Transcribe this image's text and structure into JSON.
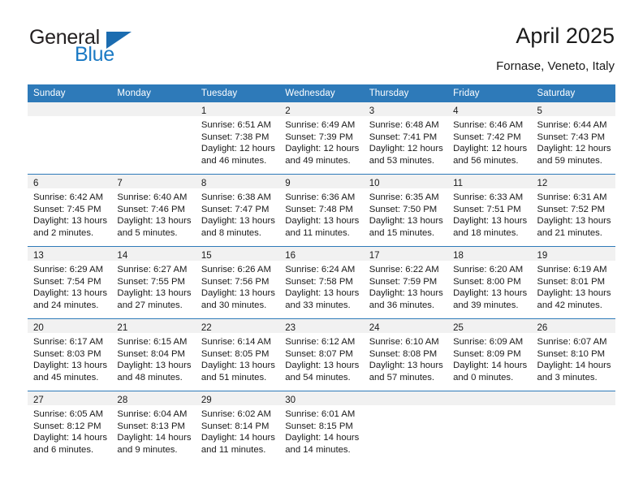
{
  "logo": {
    "word_top": "General",
    "word_bottom": "Blue",
    "triangle_color": "#1b6cb0",
    "blue_color": "#1b7ac4"
  },
  "header": {
    "title": "April 2025",
    "subtitle": "Fornase, Veneto, Italy"
  },
  "theme": {
    "header_blue": "#2e7ab9",
    "daynum_strip": "#f1f1f1",
    "text": "#1a1a1a"
  },
  "weekday_headers": [
    "Sunday",
    "Monday",
    "Tuesday",
    "Wednesday",
    "Thursday",
    "Friday",
    "Saturday"
  ],
  "weeks": [
    [
      {
        "day": "",
        "sunrise": "",
        "sunset": "",
        "daylight_1": "",
        "daylight_2": ""
      },
      {
        "day": "",
        "sunrise": "",
        "sunset": "",
        "daylight_1": "",
        "daylight_2": ""
      },
      {
        "day": "1",
        "sunrise": "Sunrise: 6:51 AM",
        "sunset": "Sunset: 7:38 PM",
        "daylight_1": "Daylight: 12 hours",
        "daylight_2": "and 46 minutes."
      },
      {
        "day": "2",
        "sunrise": "Sunrise: 6:49 AM",
        "sunset": "Sunset: 7:39 PM",
        "daylight_1": "Daylight: 12 hours",
        "daylight_2": "and 49 minutes."
      },
      {
        "day": "3",
        "sunrise": "Sunrise: 6:48 AM",
        "sunset": "Sunset: 7:41 PM",
        "daylight_1": "Daylight: 12 hours",
        "daylight_2": "and 53 minutes."
      },
      {
        "day": "4",
        "sunrise": "Sunrise: 6:46 AM",
        "sunset": "Sunset: 7:42 PM",
        "daylight_1": "Daylight: 12 hours",
        "daylight_2": "and 56 minutes."
      },
      {
        "day": "5",
        "sunrise": "Sunrise: 6:44 AM",
        "sunset": "Sunset: 7:43 PM",
        "daylight_1": "Daylight: 12 hours",
        "daylight_2": "and 59 minutes."
      }
    ],
    [
      {
        "day": "6",
        "sunrise": "Sunrise: 6:42 AM",
        "sunset": "Sunset: 7:45 PM",
        "daylight_1": "Daylight: 13 hours",
        "daylight_2": "and 2 minutes."
      },
      {
        "day": "7",
        "sunrise": "Sunrise: 6:40 AM",
        "sunset": "Sunset: 7:46 PM",
        "daylight_1": "Daylight: 13 hours",
        "daylight_2": "and 5 minutes."
      },
      {
        "day": "8",
        "sunrise": "Sunrise: 6:38 AM",
        "sunset": "Sunset: 7:47 PM",
        "daylight_1": "Daylight: 13 hours",
        "daylight_2": "and 8 minutes."
      },
      {
        "day": "9",
        "sunrise": "Sunrise: 6:36 AM",
        "sunset": "Sunset: 7:48 PM",
        "daylight_1": "Daylight: 13 hours",
        "daylight_2": "and 11 minutes."
      },
      {
        "day": "10",
        "sunrise": "Sunrise: 6:35 AM",
        "sunset": "Sunset: 7:50 PM",
        "daylight_1": "Daylight: 13 hours",
        "daylight_2": "and 15 minutes."
      },
      {
        "day": "11",
        "sunrise": "Sunrise: 6:33 AM",
        "sunset": "Sunset: 7:51 PM",
        "daylight_1": "Daylight: 13 hours",
        "daylight_2": "and 18 minutes."
      },
      {
        "day": "12",
        "sunrise": "Sunrise: 6:31 AM",
        "sunset": "Sunset: 7:52 PM",
        "daylight_1": "Daylight: 13 hours",
        "daylight_2": "and 21 minutes."
      }
    ],
    [
      {
        "day": "13",
        "sunrise": "Sunrise: 6:29 AM",
        "sunset": "Sunset: 7:54 PM",
        "daylight_1": "Daylight: 13 hours",
        "daylight_2": "and 24 minutes."
      },
      {
        "day": "14",
        "sunrise": "Sunrise: 6:27 AM",
        "sunset": "Sunset: 7:55 PM",
        "daylight_1": "Daylight: 13 hours",
        "daylight_2": "and 27 minutes."
      },
      {
        "day": "15",
        "sunrise": "Sunrise: 6:26 AM",
        "sunset": "Sunset: 7:56 PM",
        "daylight_1": "Daylight: 13 hours",
        "daylight_2": "and 30 minutes."
      },
      {
        "day": "16",
        "sunrise": "Sunrise: 6:24 AM",
        "sunset": "Sunset: 7:58 PM",
        "daylight_1": "Daylight: 13 hours",
        "daylight_2": "and 33 minutes."
      },
      {
        "day": "17",
        "sunrise": "Sunrise: 6:22 AM",
        "sunset": "Sunset: 7:59 PM",
        "daylight_1": "Daylight: 13 hours",
        "daylight_2": "and 36 minutes."
      },
      {
        "day": "18",
        "sunrise": "Sunrise: 6:20 AM",
        "sunset": "Sunset: 8:00 PM",
        "daylight_1": "Daylight: 13 hours",
        "daylight_2": "and 39 minutes."
      },
      {
        "day": "19",
        "sunrise": "Sunrise: 6:19 AM",
        "sunset": "Sunset: 8:01 PM",
        "daylight_1": "Daylight: 13 hours",
        "daylight_2": "and 42 minutes."
      }
    ],
    [
      {
        "day": "20",
        "sunrise": "Sunrise: 6:17 AM",
        "sunset": "Sunset: 8:03 PM",
        "daylight_1": "Daylight: 13 hours",
        "daylight_2": "and 45 minutes."
      },
      {
        "day": "21",
        "sunrise": "Sunrise: 6:15 AM",
        "sunset": "Sunset: 8:04 PM",
        "daylight_1": "Daylight: 13 hours",
        "daylight_2": "and 48 minutes."
      },
      {
        "day": "22",
        "sunrise": "Sunrise: 6:14 AM",
        "sunset": "Sunset: 8:05 PM",
        "daylight_1": "Daylight: 13 hours",
        "daylight_2": "and 51 minutes."
      },
      {
        "day": "23",
        "sunrise": "Sunrise: 6:12 AM",
        "sunset": "Sunset: 8:07 PM",
        "daylight_1": "Daylight: 13 hours",
        "daylight_2": "and 54 minutes."
      },
      {
        "day": "24",
        "sunrise": "Sunrise: 6:10 AM",
        "sunset": "Sunset: 8:08 PM",
        "daylight_1": "Daylight: 13 hours",
        "daylight_2": "and 57 minutes."
      },
      {
        "day": "25",
        "sunrise": "Sunrise: 6:09 AM",
        "sunset": "Sunset: 8:09 PM",
        "daylight_1": "Daylight: 14 hours",
        "daylight_2": "and 0 minutes."
      },
      {
        "day": "26",
        "sunrise": "Sunrise: 6:07 AM",
        "sunset": "Sunset: 8:10 PM",
        "daylight_1": "Daylight: 14 hours",
        "daylight_2": "and 3 minutes."
      }
    ],
    [
      {
        "day": "27",
        "sunrise": "Sunrise: 6:05 AM",
        "sunset": "Sunset: 8:12 PM",
        "daylight_1": "Daylight: 14 hours",
        "daylight_2": "and 6 minutes."
      },
      {
        "day": "28",
        "sunrise": "Sunrise: 6:04 AM",
        "sunset": "Sunset: 8:13 PM",
        "daylight_1": "Daylight: 14 hours",
        "daylight_2": "and 9 minutes."
      },
      {
        "day": "29",
        "sunrise": "Sunrise: 6:02 AM",
        "sunset": "Sunset: 8:14 PM",
        "daylight_1": "Daylight: 14 hours",
        "daylight_2": "and 11 minutes."
      },
      {
        "day": "30",
        "sunrise": "Sunrise: 6:01 AM",
        "sunset": "Sunset: 8:15 PM",
        "daylight_1": "Daylight: 14 hours",
        "daylight_2": "and 14 minutes."
      },
      {
        "day": "",
        "sunrise": "",
        "sunset": "",
        "daylight_1": "",
        "daylight_2": ""
      },
      {
        "day": "",
        "sunrise": "",
        "sunset": "",
        "daylight_1": "",
        "daylight_2": ""
      },
      {
        "day": "",
        "sunrise": "",
        "sunset": "",
        "daylight_1": "",
        "daylight_2": ""
      }
    ]
  ]
}
